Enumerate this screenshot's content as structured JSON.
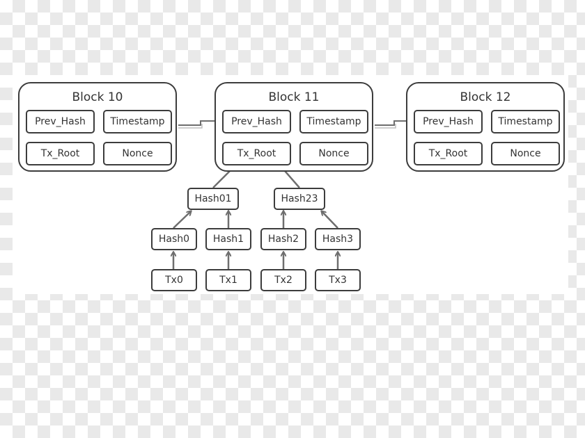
{
  "diagram": {
    "blocks": [
      {
        "title": "Block 10",
        "fields": {
          "prev_hash": "Prev_Hash",
          "timestamp": "Timestamp",
          "tx_root": "Tx_Root",
          "nonce": "Nonce"
        }
      },
      {
        "title": "Block 11",
        "fields": {
          "prev_hash": "Prev_Hash",
          "timestamp": "Timestamp",
          "tx_root": "Tx_Root",
          "nonce": "Nonce"
        }
      },
      {
        "title": "Block 12",
        "fields": {
          "prev_hash": "Prev_Hash",
          "timestamp": "Timestamp",
          "tx_root": "Tx_Root",
          "nonce": "Nonce"
        }
      }
    ],
    "merkle_tree": {
      "level1": [
        "Hash01",
        "Hash23"
      ],
      "level2": [
        "Hash0",
        "Hash1",
        "Hash2",
        "Hash3"
      ],
      "transactions": [
        "Tx0",
        "Tx1",
        "Tx2",
        "Tx3"
      ]
    },
    "edges": [
      {
        "from": "Block 10",
        "to": "Block 11.Prev_Hash"
      },
      {
        "from": "Block 11",
        "to": "Block 12.Prev_Hash"
      },
      {
        "from": "Hash01",
        "to": "Block 11.Tx_Root"
      },
      {
        "from": "Hash23",
        "to": "Block 11.Tx_Root"
      },
      {
        "from": "Hash0",
        "to": "Hash01"
      },
      {
        "from": "Hash1",
        "to": "Hash01"
      },
      {
        "from": "Hash2",
        "to": "Hash23"
      },
      {
        "from": "Hash3",
        "to": "Hash23"
      },
      {
        "from": "Tx0",
        "to": "Hash0"
      },
      {
        "from": "Tx1",
        "to": "Hash1"
      },
      {
        "from": "Tx2",
        "to": "Hash2"
      },
      {
        "from": "Tx3",
        "to": "Hash3"
      }
    ],
    "colors": {
      "stroke": "#3c3c3c",
      "arrow": "#6e6e6e",
      "text": "#333333"
    }
  }
}
